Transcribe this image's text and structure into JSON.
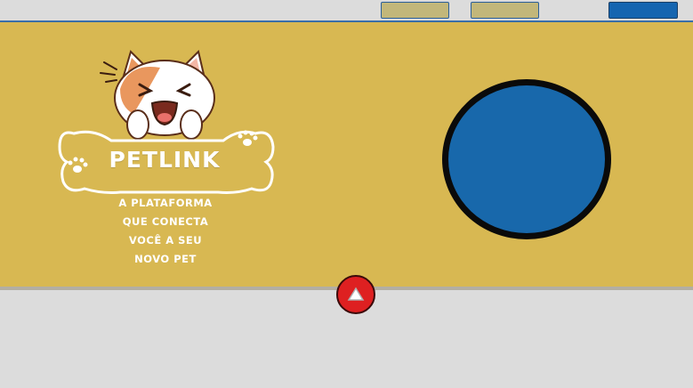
{
  "nav": {
    "buttons": [
      {
        "label": "",
        "color": "#c2b77a"
      },
      {
        "label": "",
        "color": "#c2b77a"
      },
      {
        "label": "",
        "color": "#1565b0"
      }
    ]
  },
  "hero": {
    "title": "PETLINK",
    "tagline_lines": [
      "A PLATAFORMA",
      "QUE CONECTA",
      "VOCÊ A SEU",
      "NOVO PET"
    ],
    "background_color": "#d8b852",
    "circle_color": "#1868ab",
    "logo_icon": "laughing-cat-bone-logo"
  },
  "scroll_top": {
    "icon": "triangle-up-icon",
    "color": "#de2021"
  }
}
